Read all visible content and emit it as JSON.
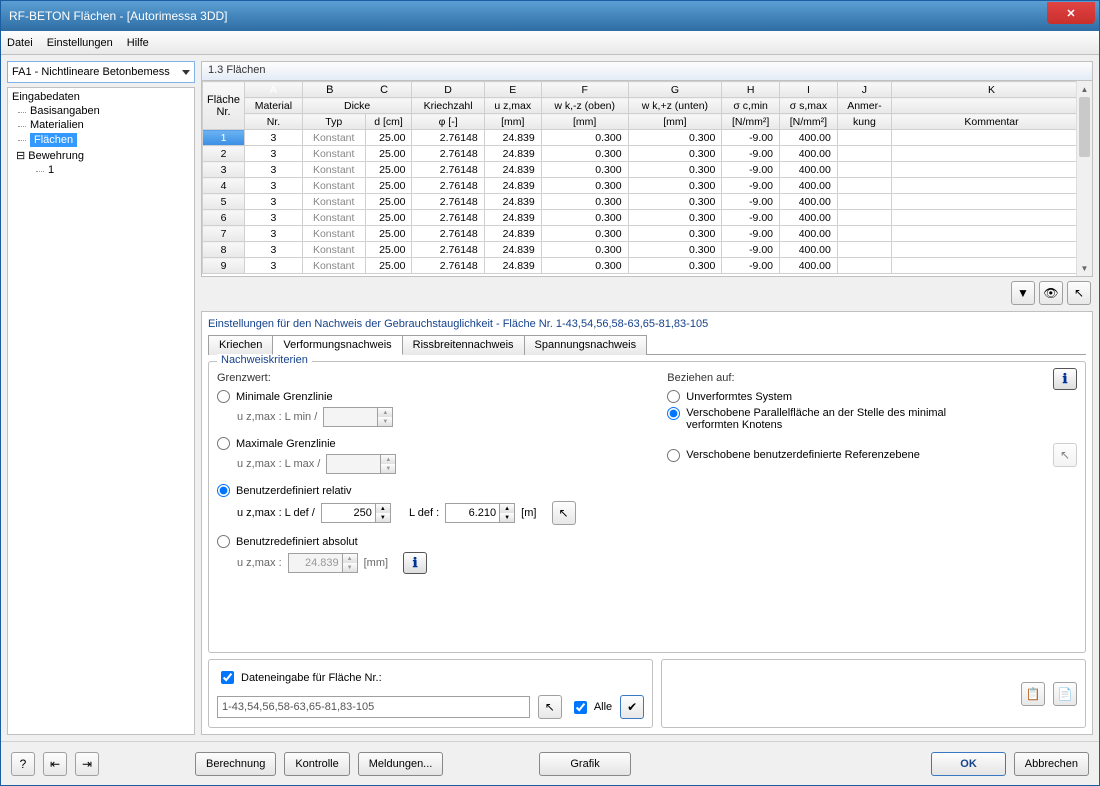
{
  "window": {
    "title": "RF-BETON Flächen - [Autorimessa 3DD]"
  },
  "menu": {
    "file": "Datei",
    "settings": "Einstellungen",
    "help": "Hilfe"
  },
  "dropdown": {
    "value": "FA1 - Nichtlineare Betonbemess"
  },
  "tree": {
    "root": "Eingabedaten",
    "n1": "Basisangaben",
    "n2": "Materialien",
    "n3": "Flächen",
    "n4": "Bewehrung",
    "n4a": "1"
  },
  "section": {
    "title": "1.3 Flächen"
  },
  "grid": {
    "letters": [
      "A",
      "B",
      "C",
      "D",
      "E",
      "F",
      "G",
      "H",
      "I",
      "J",
      "K"
    ],
    "h1": {
      "flaeche": "Fläche",
      "material": "Material",
      "dicke": "Dicke",
      "kriech": "Kriechzahl",
      "uz": "u z,max",
      "wkz": "w k,-z (oben)",
      "wkzp": "w k,+z (unten)",
      "sc": "σ c,min",
      "ss": "σ s,max",
      "anm": "Anmer-",
      "kom": ""
    },
    "h2": {
      "nr": "Nr.",
      "mnr": "Nr.",
      "typ": "Typ",
      "dcm": "d [cm]",
      "phi": "φ [-]",
      "mm": "[mm]",
      "mm2": "[mm]",
      "mm3": "[mm]",
      "nmm1": "[N/mm²]",
      "nmm2": "[N/mm²]",
      "kung": "kung",
      "komm": "Kommentar"
    },
    "rows": [
      {
        "n": "1",
        "m": "3",
        "typ": "Konstant",
        "d": "25.00",
        "phi": "2.76148",
        "uz": "24.839",
        "wk1": "0.300",
        "wk2": "0.300",
        "sc": "-9.00",
        "ss": "400.00"
      },
      {
        "n": "2",
        "m": "3",
        "typ": "Konstant",
        "d": "25.00",
        "phi": "2.76148",
        "uz": "24.839",
        "wk1": "0.300",
        "wk2": "0.300",
        "sc": "-9.00",
        "ss": "400.00"
      },
      {
        "n": "3",
        "m": "3",
        "typ": "Konstant",
        "d": "25.00",
        "phi": "2.76148",
        "uz": "24.839",
        "wk1": "0.300",
        "wk2": "0.300",
        "sc": "-9.00",
        "ss": "400.00"
      },
      {
        "n": "4",
        "m": "3",
        "typ": "Konstant",
        "d": "25.00",
        "phi": "2.76148",
        "uz": "24.839",
        "wk1": "0.300",
        "wk2": "0.300",
        "sc": "-9.00",
        "ss": "400.00"
      },
      {
        "n": "5",
        "m": "3",
        "typ": "Konstant",
        "d": "25.00",
        "phi": "2.76148",
        "uz": "24.839",
        "wk1": "0.300",
        "wk2": "0.300",
        "sc": "-9.00",
        "ss": "400.00"
      },
      {
        "n": "6",
        "m": "3",
        "typ": "Konstant",
        "d": "25.00",
        "phi": "2.76148",
        "uz": "24.839",
        "wk1": "0.300",
        "wk2": "0.300",
        "sc": "-9.00",
        "ss": "400.00"
      },
      {
        "n": "7",
        "m": "3",
        "typ": "Konstant",
        "d": "25.00",
        "phi": "2.76148",
        "uz": "24.839",
        "wk1": "0.300",
        "wk2": "0.300",
        "sc": "-9.00",
        "ss": "400.00"
      },
      {
        "n": "8",
        "m": "3",
        "typ": "Konstant",
        "d": "25.00",
        "phi": "2.76148",
        "uz": "24.839",
        "wk1": "0.300",
        "wk2": "0.300",
        "sc": "-9.00",
        "ss": "400.00"
      },
      {
        "n": "9",
        "m": "3",
        "typ": "Konstant",
        "d": "25.00",
        "phi": "2.76148",
        "uz": "24.839",
        "wk1": "0.300",
        "wk2": "0.300",
        "sc": "-9.00",
        "ss": "400.00"
      }
    ]
  },
  "settings": {
    "heading": "Einstellungen für den Nachweis der Gebrauchstauglichkeit - Fläche Nr. 1-43,54,56,58-63,65-81,83-105",
    "tabs": {
      "t1": "Kriechen",
      "t2": "Verformungsnachweis",
      "t3": "Rissbreitennachweis",
      "t4": "Spannungsnachweis"
    },
    "group": "Nachweiskriterien",
    "grenzwert": "Grenzwert:",
    "r1": "Minimale Grenzlinie",
    "r1s": "u z,max :   L min /",
    "r2": "Maximale Grenzlinie",
    "r2s": "u z,max :   L max /",
    "r3": "Benutzerdefiniert relativ",
    "r3s": "u z,max :   L def /",
    "r3val": "250",
    "r3ldef": "L def :",
    "r3ldefval": "6.210",
    "r3unit": "[m]",
    "r4": "Benutzredefiniert absolut",
    "r4s": "u z,max :",
    "r4val": "24.839",
    "r4unit": "[mm]",
    "beziehen": "Beziehen auf:",
    "b1": "Unverformtes System",
    "b2": "Verschobene Parallelfläche an der Stelle des minimal verformten Knotens",
    "b3": "Verschobene benutzerdefinierte Referenzebene",
    "datacheck": "Dateneingabe für Fläche Nr.:",
    "datainput": "1-43,54,56,58-63,65-81,83-105",
    "alle": "Alle"
  },
  "footer": {
    "berechnung": "Berechnung",
    "kontrolle": "Kontrolle",
    "meldungen": "Meldungen...",
    "grafik": "Grafik",
    "ok": "OK",
    "abbrechen": "Abbrechen"
  }
}
